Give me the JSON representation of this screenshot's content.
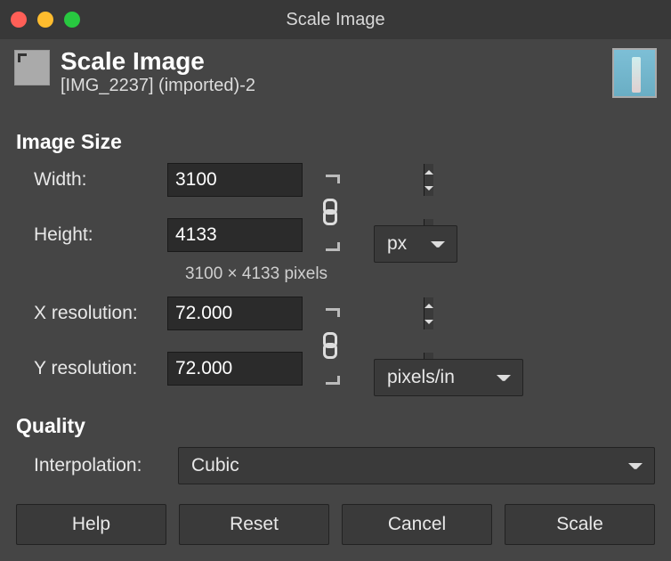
{
  "window": {
    "title": "Scale Image"
  },
  "header": {
    "title": "Scale Image",
    "subtitle": "[IMG_2237] (imported)-2"
  },
  "sections": {
    "image_size_title": "Image Size",
    "quality_title": "Quality"
  },
  "labels": {
    "width": "Width:",
    "height": "Height:",
    "xres": "X resolution:",
    "yres": "Y resolution:",
    "interpolation": "Interpolation:"
  },
  "values": {
    "width": "3100",
    "height": "4133",
    "xres": "72.000",
    "yres": "72.000",
    "dimensions_note": "3100 × 4133 pixels"
  },
  "units": {
    "size": "px",
    "resolution": "pixels/in"
  },
  "interpolation": {
    "selected": "Cubic"
  },
  "buttons": {
    "help": "Help",
    "reset": "Reset",
    "cancel": "Cancel",
    "scale": "Scale"
  }
}
